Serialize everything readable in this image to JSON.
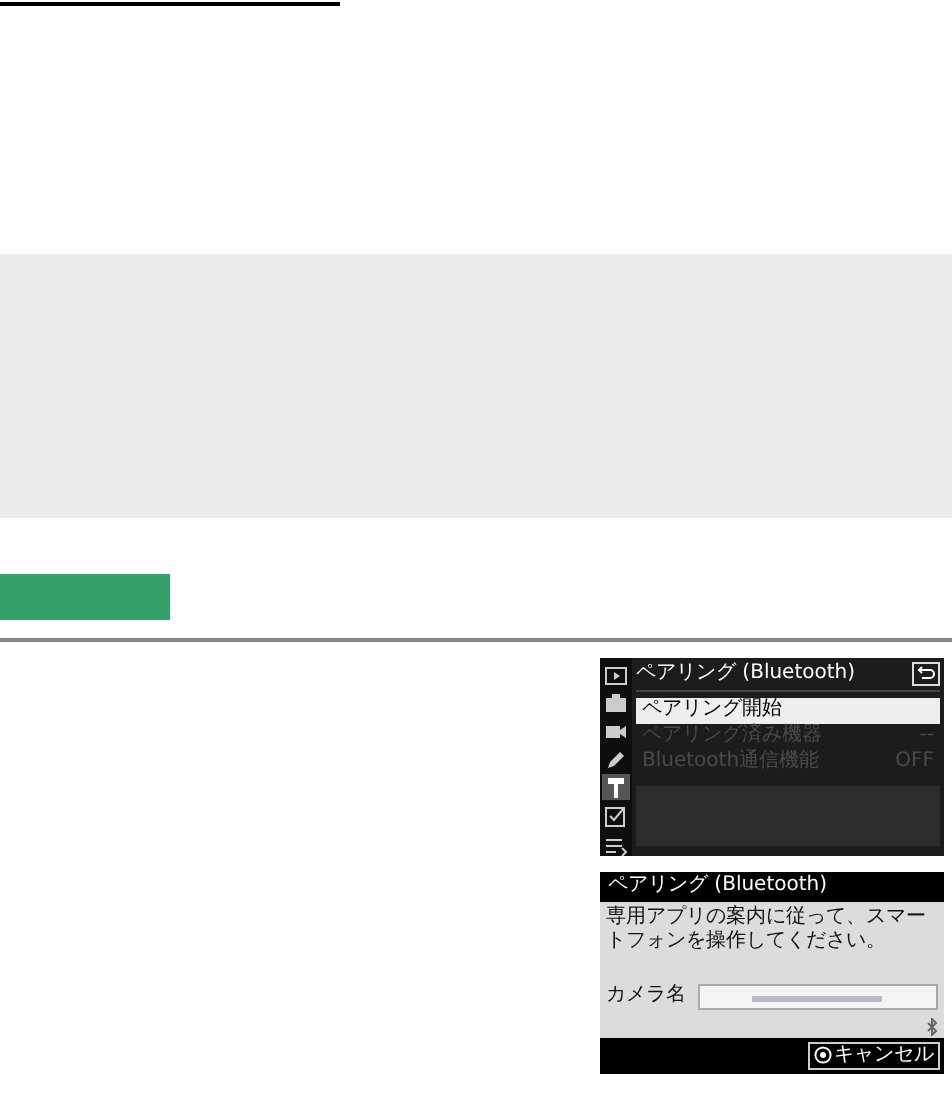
{
  "screens": [
    {
      "kind": "menu",
      "title": "ペアリング (Bluetooth)",
      "sidebar": [
        {
          "selected": false
        },
        {
          "selected": false
        },
        {
          "selected": false
        },
        {
          "selected": false
        },
        {
          "selected": true
        },
        {
          "selected": false
        },
        {
          "selected": false
        }
      ],
      "items": [
        {
          "label": "ペアリング開始",
          "value": null,
          "selected": true,
          "disabled": false
        },
        {
          "label": "ペアリング済み機器",
          "value": "--",
          "selected": false,
          "disabled": true
        },
        {
          "label": "Bluetooth通信機能",
          "value": "OFF",
          "selected": false,
          "disabled": true
        }
      ]
    },
    {
      "kind": "dialog",
      "title": "ペアリング (Bluetooth)",
      "message": "専用アプリの案内に従って、スマートフォンを操作してください。",
      "field_label": "カメラ名",
      "button": "キャンセル"
    }
  ]
}
